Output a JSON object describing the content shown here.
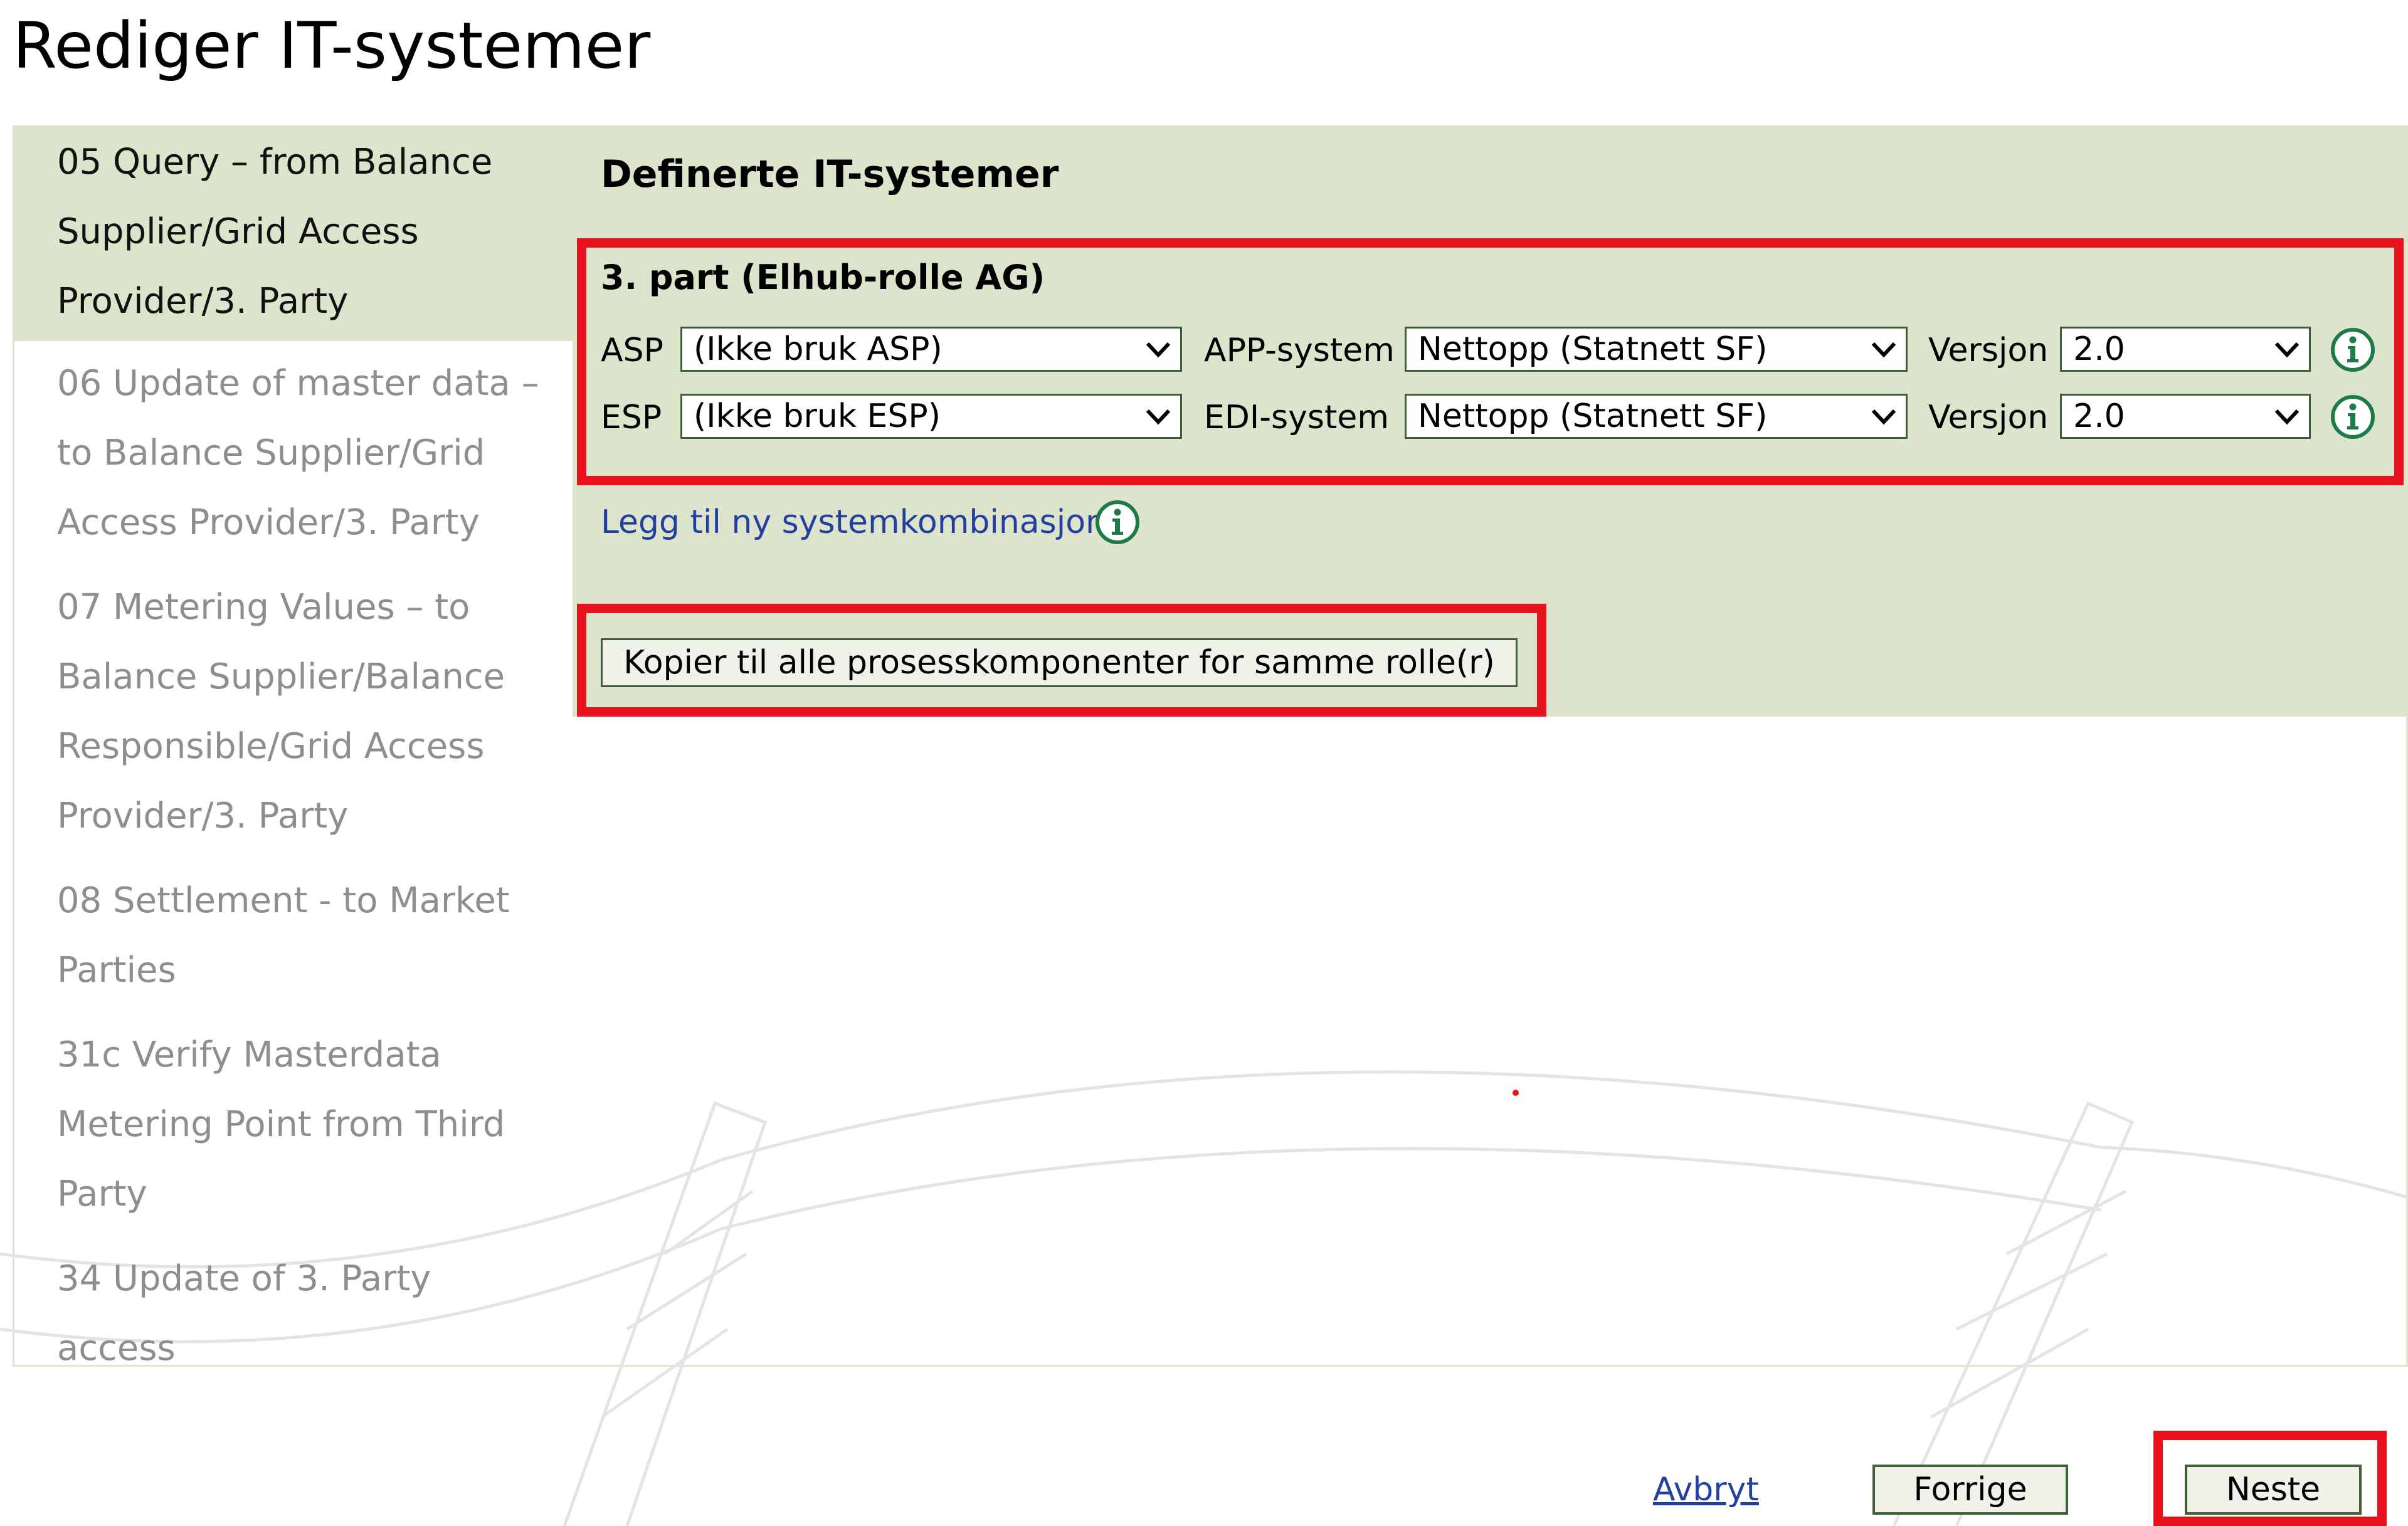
{
  "page": {
    "title": "Rediger IT-systemer"
  },
  "sidebar": {
    "items": [
      {
        "label": "05 Query – from Balance Supplier/Grid Access Provider/3. Party",
        "active": true
      },
      {
        "label": "06 Update of master data – to Balance Supplier/Grid Access Provider/3. Party",
        "active": false
      },
      {
        "label": "07 Metering Values – to Balance Supplier/Balance Responsible/Grid Access Provider/3. Party",
        "active": false
      },
      {
        "label": "08 Settlement - to Market Parties",
        "active": false
      },
      {
        "label": "31c Verify Masterdata Metering Point from Third Party",
        "active": false
      },
      {
        "label": "34 Update of 3. Party access",
        "active": false
      }
    ]
  },
  "main": {
    "heading": "Definerte IT-systemer",
    "role_heading": "3. part (Elhub-rolle AG)",
    "rows": [
      {
        "provider_label": "ASP",
        "provider_value": "(Ikke bruk ASP)",
        "system_label": "APP-system",
        "system_value": "Nettopp (Statnett SF)",
        "version_label": "Versjon",
        "version_value": "2.0"
      },
      {
        "provider_label": "ESP",
        "provider_value": "(Ikke bruk ESP)",
        "system_label": "EDI-system",
        "system_value": "Nettopp (Statnett SF)",
        "version_label": "Versjon",
        "version_value": "2.0"
      }
    ],
    "add_link": "Legg til ny systemkombinasjon",
    "copy_button": "Kopier til alle prosesskomponenter for samme rolle(r)"
  },
  "footer": {
    "cancel": "Avbryt",
    "previous": "Forrige",
    "next": "Neste"
  },
  "colors": {
    "panel_green": "#dce5cb",
    "highlight_red": "#e8131e",
    "link_blue": "#2340a0",
    "icon_green": "#1f7a4a"
  },
  "icons": {
    "info": "info-icon",
    "dropdown": "chevron-down-icon"
  }
}
